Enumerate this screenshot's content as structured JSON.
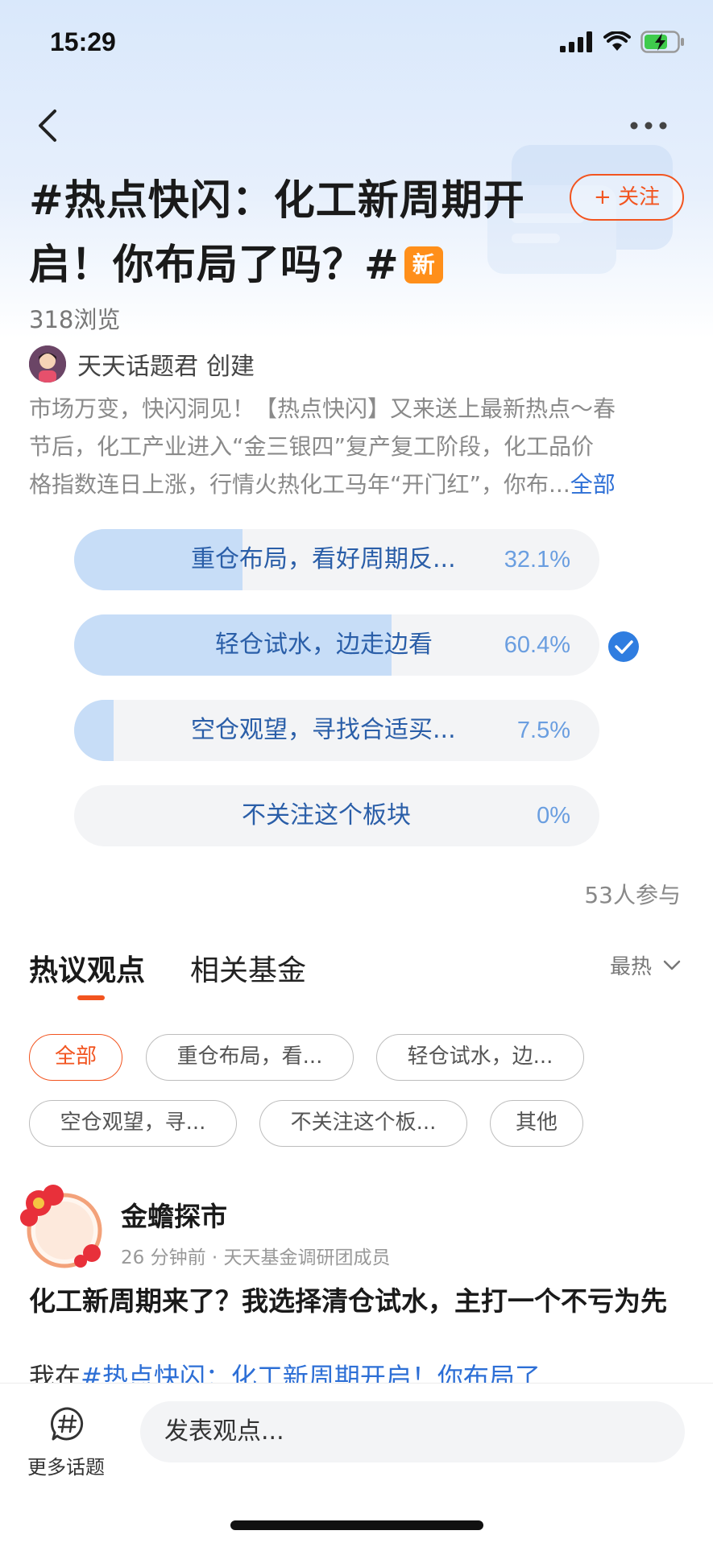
{
  "status_bar": {
    "time": "15:29"
  },
  "nav": {
    "back_icon": "chevron-left-icon",
    "more_icon": "more-dots-icon"
  },
  "topic": {
    "title_part1": "#热点快闪：化工新周期开",
    "title_part2": "启！你布局了吗？#",
    "new_badge": "新",
    "follow_label": "+ 关注",
    "views": "318浏览",
    "creator_name": "天天话题君",
    "creator_suffix": "创建",
    "description_lines": [
      "市场万变，快闪洞见！【热点快闪】又来送上最新热点～春",
      "节后，化工产业进入“金三银四”复产复工阶段，化工品价",
      "格指数连日上涨，行情火热化工马年“开门红”，你布..."
    ],
    "description_more": "全部"
  },
  "poll": {
    "options": [
      {
        "label": "重仓布局，看好周期反...",
        "percent_text": "32.1%",
        "share": 0.321,
        "selected": false
      },
      {
        "label": "轻仓试水，边走边看",
        "percent_text": "60.4%",
        "share": 0.604,
        "selected": true
      },
      {
        "label": "空仓观望，寻找合适买...",
        "percent_text": "7.5%",
        "share": 0.075,
        "selected": false
      },
      {
        "label": "不关注这个板块",
        "percent_text": "0%",
        "share": 0,
        "selected": false
      }
    ],
    "participants": "53人参与"
  },
  "tabs": {
    "hot": "热议观点",
    "funds": "相关基金",
    "sort_label": "最热"
  },
  "filters": [
    "全部",
    "重仓布局，看...",
    "轻仓试水，边...",
    "空仓观望，寻...",
    "不关注这个板...",
    "其他"
  ],
  "post": {
    "author": "金蟾探市",
    "meta": "26 分钟前 · 天天基金调研团成员",
    "title": "化工新周期来了？我选择清仓试水，主打一个不亏为先",
    "body_prefix": "我在",
    "body_tag": "#热点快闪：化工新周期开启！你布局了"
  },
  "bottom_bar": {
    "more_topics": "更多话题",
    "input_placeholder": "发表观点..."
  },
  "colors": {
    "accent": "#f2541f",
    "link": "#2d6fd6",
    "poll_fill": "#c7ddf7",
    "badge": "#ff8f1a"
  }
}
